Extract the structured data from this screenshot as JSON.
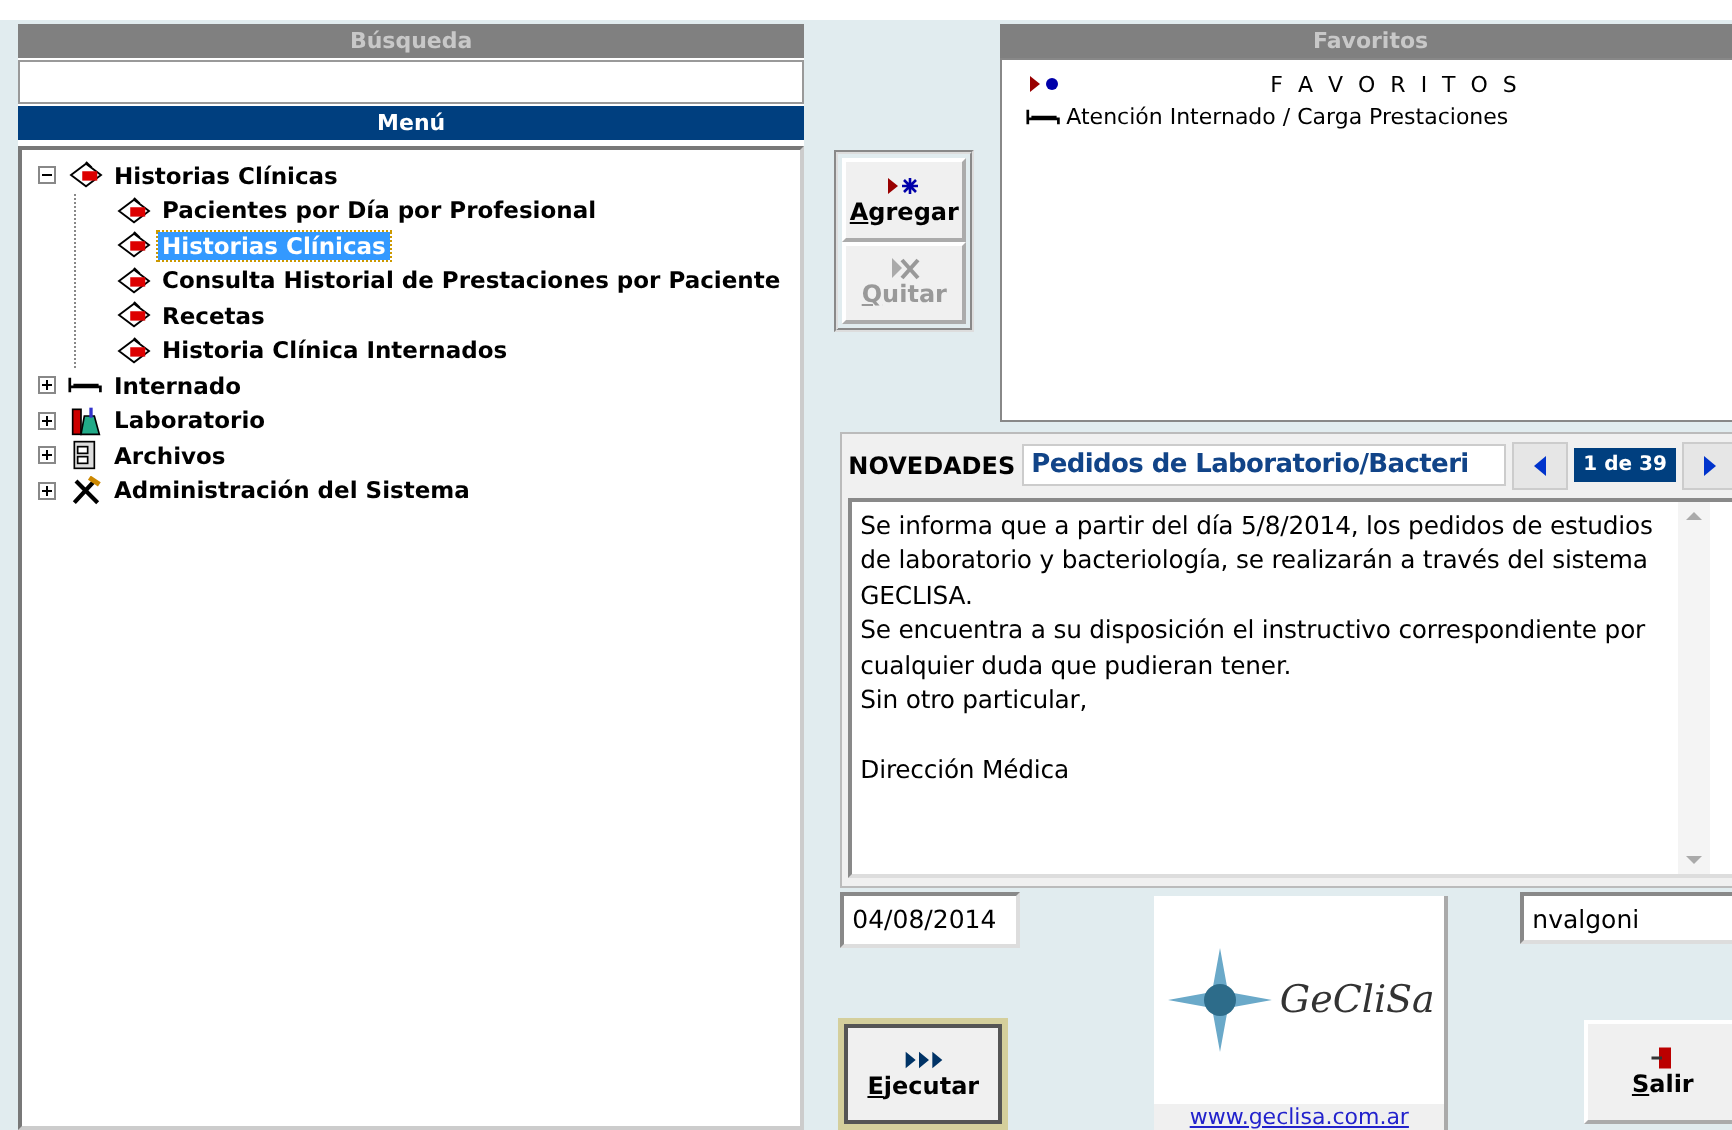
{
  "search": {
    "header": "Búsqueda"
  },
  "menu": {
    "header": "Menú",
    "items": [
      {
        "label": "Historias Clínicas",
        "expanded": true,
        "selected": false,
        "children": [
          {
            "label": "Pacientes por Día por Profesional",
            "selected": false
          },
          {
            "label": "Historias Clínicas",
            "selected": true
          },
          {
            "label": "Consulta Historial de Prestaciones por Paciente",
            "selected": false
          },
          {
            "label": "Recetas",
            "selected": false
          },
          {
            "label": "Historia Clínica Internados",
            "selected": false
          }
        ]
      },
      {
        "label": "Internado",
        "expanded": false,
        "selected": false
      },
      {
        "label": "Laboratorio",
        "expanded": false,
        "selected": false
      },
      {
        "label": "Archivos",
        "expanded": false,
        "selected": false
      },
      {
        "label": "Administración del Sistema",
        "expanded": false,
        "selected": false
      }
    ]
  },
  "favorite_buttons": [
    {
      "kind": "add",
      "label": "Agregar",
      "disabled": false
    },
    {
      "kind": "remove",
      "label": "Quitar",
      "disabled": true
    }
  ],
  "favorites": {
    "header": "Favoritos",
    "root": "F A V O R I T O S",
    "items": [
      {
        "label": "Atención Internado / Carga Prestaciones"
      }
    ]
  },
  "news": {
    "label": "NOVEDADES",
    "title": "Pedidos de Laboratorio/Bacteri",
    "counter": "1 de 39",
    "paragraphs": [
      [
        "Se informa que a partir del día 5/8/2014, los pedidos de estudios de laboratorio y bacteriología, se realizarán a través del sistema GECLISA.",
        "Se encuentra a su disposición el instructivo correspondiente por cualquier duda que pudieran tener.",
        "Sin otro particular,"
      ],
      [
        "Dirección Médica"
      ]
    ]
  },
  "date": "04/08/2014",
  "user": "nvalgoni",
  "logo": {
    "name": "GeCliSa",
    "link": "www.geclisa.com.ar"
  },
  "actions": [
    {
      "kind": "run",
      "label": "Ejecutar",
      "focused": true
    },
    {
      "kind": "exit",
      "label": "Salir",
      "focused": false
    }
  ]
}
